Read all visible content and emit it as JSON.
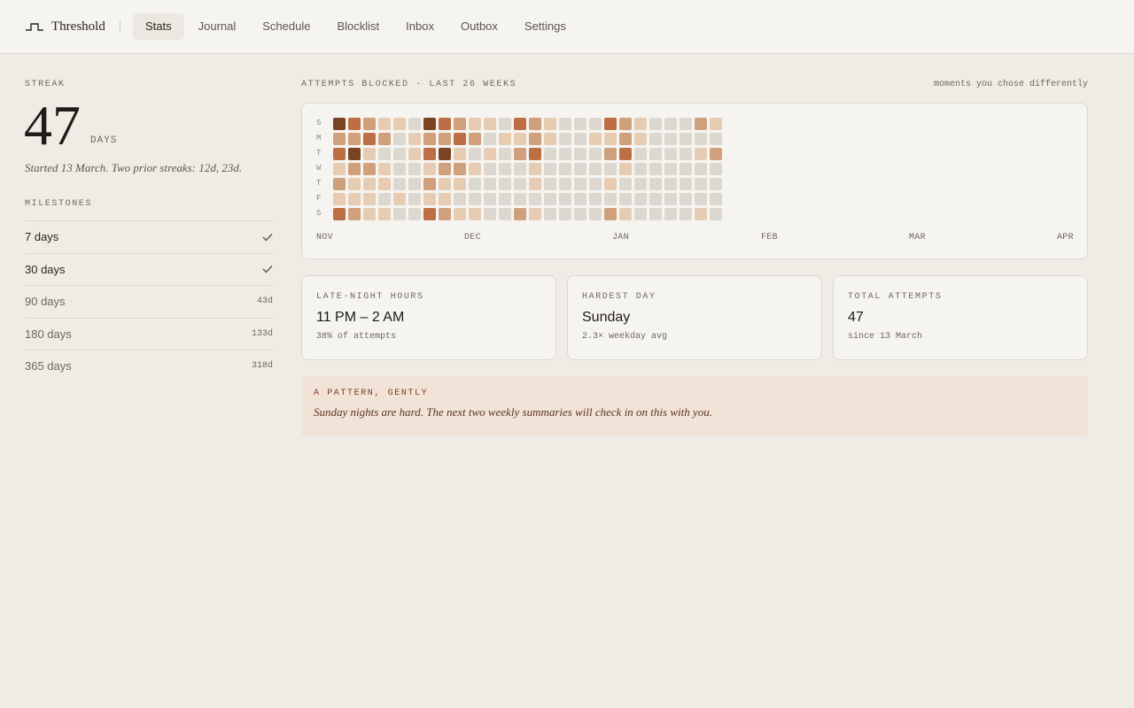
{
  "app": {
    "brand": "Threshold",
    "brand_icon": "threshold-step-icon"
  },
  "nav": {
    "items": [
      {
        "label": "Stats",
        "active": true
      },
      {
        "label": "Journal",
        "active": false
      },
      {
        "label": "Schedule",
        "active": false
      },
      {
        "label": "Blocklist",
        "active": false
      },
      {
        "label": "Inbox",
        "active": false
      },
      {
        "label": "Outbox",
        "active": false
      },
      {
        "label": "Settings",
        "active": false
      }
    ]
  },
  "streak": {
    "label": "STREAK",
    "value": "47",
    "unit": "DAYS",
    "note": "Started 13 March. Two prior streaks: 12d, 23d."
  },
  "milestones": {
    "label": "MILESTONES",
    "items": [
      {
        "name": "7 days",
        "done": true,
        "remaining": ""
      },
      {
        "name": "30 days",
        "done": true,
        "remaining": ""
      },
      {
        "name": "90 days",
        "done": false,
        "remaining": "43d"
      },
      {
        "name": "180 days",
        "done": false,
        "remaining": "133d"
      },
      {
        "name": "365 days",
        "done": false,
        "remaining": "318d"
      }
    ]
  },
  "heatmap": {
    "title": "ATTEMPTS BLOCKED · LAST 26 WEEKS",
    "caption": "moments you chose differently",
    "day_labels": [
      "S",
      "M",
      "T",
      "W",
      "T",
      "F",
      "S"
    ],
    "months": [
      "NOV",
      "DEC",
      "JAN",
      "FEB",
      "MAR",
      "APR"
    ],
    "colors": [
      "#dcd8d0",
      "#e6ccb2",
      "#d0a07c",
      "#bd6e45",
      "#7a4322"
    ],
    "levels": [
      [
        4,
        3,
        2,
        1,
        1,
        0,
        4,
        3,
        2,
        1,
        1,
        0,
        3,
        2,
        1,
        0,
        0,
        0,
        3,
        2,
        1,
        0,
        0,
        0,
        2,
        1
      ],
      [
        2,
        2,
        3,
        2,
        0,
        1,
        2,
        2,
        3,
        2,
        0,
        1,
        1,
        2,
        1,
        0,
        0,
        1,
        1,
        2,
        1,
        0,
        0,
        0,
        0,
        0
      ],
      [
        3,
        4,
        1,
        0,
        0,
        1,
        3,
        4,
        1,
        0,
        1,
        0,
        2,
        3,
        0,
        0,
        0,
        0,
        2,
        3,
        0,
        0,
        0,
        0,
        1,
        2
      ],
      [
        1,
        2,
        2,
        1,
        0,
        0,
        1,
        2,
        2,
        1,
        0,
        0,
        0,
        1,
        0,
        0,
        0,
        0,
        0,
        1,
        0,
        0,
        0,
        0,
        0,
        0
      ],
      [
        2,
        1,
        1,
        1,
        0,
        0,
        2,
        1,
        1,
        0,
        0,
        0,
        0,
        1,
        0,
        0,
        0,
        0,
        1,
        0,
        0,
        0,
        0,
        0,
        0,
        0
      ],
      [
        1,
        1,
        1,
        0,
        1,
        0,
        1,
        1,
        0,
        0,
        0,
        0,
        0,
        0,
        0,
        0,
        0,
        0,
        0,
        0,
        0,
        0,
        0,
        0,
        0,
        0
      ],
      [
        3,
        2,
        1,
        1,
        0,
        0,
        3,
        2,
        1,
        1,
        0,
        0,
        2,
        1,
        0,
        0,
        0,
        0,
        2,
        1,
        0,
        0,
        0,
        0,
        1,
        0
      ]
    ]
  },
  "stats": [
    {
      "label": "LATE-NIGHT HOURS",
      "value": "11 PM – 2 AM",
      "sub": "38% of attempts"
    },
    {
      "label": "HARDEST DAY",
      "value": "Sunday",
      "sub": "2.3× weekday avg"
    },
    {
      "label": "TOTAL ATTEMPTS",
      "value": "47",
      "sub": "since 13 March"
    }
  ],
  "pattern": {
    "label": "A PATTERN, GENTLY",
    "text": "Sunday nights are hard. The next two weekly summaries will check in on this with you."
  }
}
